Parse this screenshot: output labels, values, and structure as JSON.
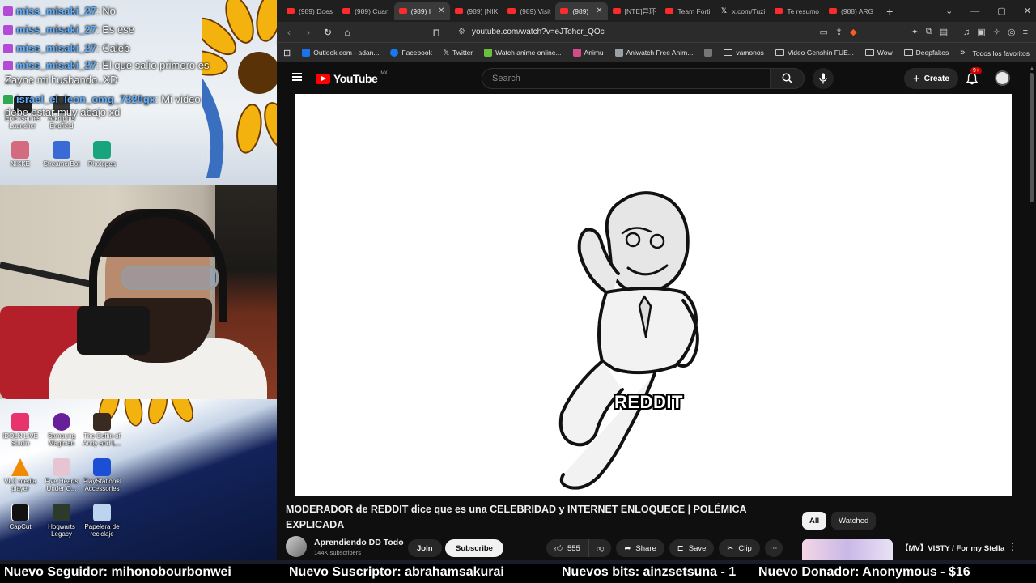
{
  "chat": {
    "messages": [
      {
        "user": "miss_misaki_27",
        "message": "No",
        "badge_color": "#b44bd6"
      },
      {
        "user": "miss_misaki_27",
        "message": "Es ese",
        "badge_color": "#b44bd6"
      },
      {
        "user": "miss_misaki_27",
        "message": "Caleb",
        "badge_color": "#b44bd6"
      },
      {
        "user": "miss_misaki_27",
        "message": "El que salio primero es",
        "badge_color": "#b44bd6"
      }
    ],
    "wrap_line_1": "Zayne mi husbando..XD",
    "message_5_user": "israel_el_leon_omg_7320gx",
    "message_5_text": "Mi video",
    "wrap_line_2": "debe estar muy abajo xd"
  },
  "desktop": {
    "top_icons": [
      {
        "label": "Epic Games Launcher",
        "color": "#222222"
      },
      {
        "label": "Arknights Endfield",
        "color": "#3a3a3a"
      },
      {
        "label": "NIKKE",
        "color": "#d46a7e"
      },
      {
        "label": "StreamerBot",
        "color": "#3a6ad4"
      },
      {
        "label": "Photopea",
        "color": "#18a57c"
      }
    ],
    "bottom_icons": [
      {
        "label": "IDOLN LIVE Studio",
        "color": "#e8336d"
      },
      {
        "label": "Samsung Magician",
        "color": "#6a1f9a"
      },
      {
        "label": "The Coffin of Andy and L...",
        "color": "#3b2a20"
      },
      {
        "label": "VLC media player",
        "color": "#f08a00"
      },
      {
        "label": "Five Hearts Under O...",
        "color": "#e7c4d2"
      },
      {
        "label": "PlayStation® Accessories",
        "color": "#1a4fd6"
      },
      {
        "label": "CapCut",
        "color": "#111111"
      },
      {
        "label": "Hogwarts Legacy",
        "color": "#2b3a2b"
      },
      {
        "label": "Papelera de reciclaje",
        "color": "#bcd4ee"
      }
    ]
  },
  "browser": {
    "tabs": [
      {
        "label": "(989) Does",
        "type": "yt",
        "active": false
      },
      {
        "label": "(989) Cuan",
        "type": "yt",
        "active": false
      },
      {
        "label": "(989) I",
        "type": "yt",
        "active": true,
        "closable": true
      },
      {
        "label": "(989) [NIK",
        "type": "yt",
        "active": false
      },
      {
        "label": "(989) Visit",
        "type": "yt",
        "active": false
      },
      {
        "label": "(989)",
        "type": "yt",
        "active": true,
        "closable": true
      },
      {
        "label": "[NTE]异环",
        "type": "yt",
        "active": false
      },
      {
        "label": "Team Forti",
        "type": "yt",
        "active": false
      },
      {
        "label": "x.com/Tuzi",
        "type": "x",
        "active": false
      },
      {
        "label": "Te resumo",
        "type": "yt",
        "active": false
      },
      {
        "label": "(988) ARG",
        "type": "yt",
        "active": false
      }
    ],
    "new_tab": "+",
    "url": "youtube.com/watch?v=eJTohcr_QOc",
    "bookmarks": [
      {
        "label": "Outlook.com - adan...",
        "icon": "square",
        "color": "#1a73e8"
      },
      {
        "label": "Facebook",
        "icon": "square",
        "color": "#1877f2"
      },
      {
        "label": "Twitter",
        "icon": "x",
        "color": "#ffffff"
      },
      {
        "label": "Watch anime online...",
        "icon": "square",
        "color": "#6bbf3a"
      },
      {
        "label": "Animu",
        "icon": "square",
        "color": "#d64a8a"
      },
      {
        "label": "Aniwatch Free Anim...",
        "icon": "square",
        "color": "#9aa0a6"
      },
      {
        "label": "",
        "icon": "square",
        "color": "#777777"
      },
      {
        "label": "vamonos",
        "icon": "folder",
        "color": "#cccccc"
      },
      {
        "label": "Video Genshin FUE...",
        "icon": "folder",
        "color": "#cccccc"
      },
      {
        "label": "Wow",
        "icon": "folder",
        "color": "#cccccc"
      },
      {
        "label": "Deepfakes",
        "icon": "folder",
        "color": "#cccccc"
      }
    ],
    "bookmarks_overflow": "»",
    "all_bookmarks": "Todos los favoritos"
  },
  "youtube": {
    "logo_text": "YouTube",
    "region": "MX",
    "search_placeholder": "Search",
    "create_label": "Create",
    "notification_count": "9+",
    "video_caption": "REDDIT",
    "title": "MODERADOR de REDDIT dice que es una CELEBRIDAD y INTERNET ENLOQUECE | POLÉMICA EXPLICADA",
    "channel_name": "Aprendiendo DD Todo",
    "subscriber_count": "144K subscribers",
    "join_label": "Join",
    "subscribe_label": "Subscribe",
    "likes": "555",
    "share_label": "Share",
    "save_label": "Save",
    "clip_label": "Clip",
    "filter_chips": [
      {
        "label": "All",
        "active": true
      },
      {
        "label": "Watched",
        "active": false
      }
    ],
    "recommended_title": "【MV】VISTY / For my Stella"
  },
  "ticker": {
    "items": [
      "Nuevo Seguidor: mihonobourbonwei",
      "Nuevo Suscriptor: abrahamsakurai",
      "Nuevos bits: ainzsetsuna - 1",
      "Nuevo Donador: Anonymous - $16"
    ]
  },
  "colors": {
    "yt_red": "#ff0000",
    "chat_username": "#5fb0ff",
    "dark_bg": "#0f0f0f"
  }
}
